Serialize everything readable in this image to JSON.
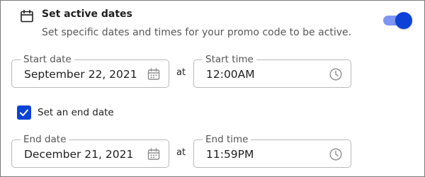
{
  "section": {
    "title": "Set active dates",
    "description": "Set specific dates and times for your promo code to be active.",
    "icon": "calendar-icon",
    "toggle_on": true
  },
  "start": {
    "date_label": "Start date",
    "date_value": "September 22, 2021",
    "at_label": "at",
    "time_label": "Start time",
    "time_value": "12:00AM"
  },
  "end_checkbox": {
    "checked": true,
    "label": "Set an end date"
  },
  "end": {
    "date_label": "End date",
    "date_value": "December 21, 2021",
    "at_label": "at",
    "time_label": "End time",
    "time_value": "11:59PM"
  },
  "colors": {
    "accent": "#0c43d6",
    "accent_light": "#7f95f2",
    "border": "#b9b9b9",
    "muted_text": "#585858"
  }
}
